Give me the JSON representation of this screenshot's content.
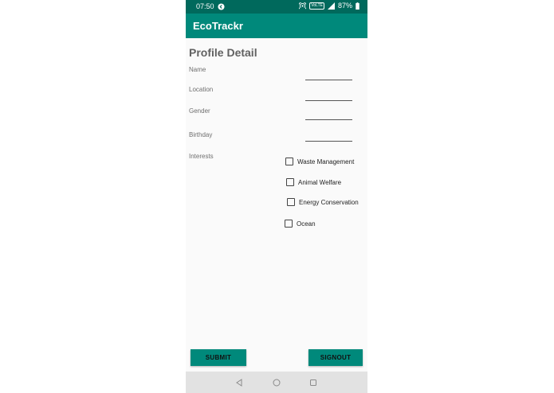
{
  "status_bar": {
    "time": "07:50",
    "volte": "VoLTE",
    "battery": "87%",
    "icons": [
      "notification-icon",
      "hotspot-icon",
      "signal-icon",
      "battery-icon"
    ]
  },
  "app_bar": {
    "title": "EcoTrackr"
  },
  "page": {
    "title": "Profile Detail",
    "fields": [
      {
        "label": "Name",
        "value": ""
      },
      {
        "label": "Location",
        "value": ""
      },
      {
        "label": "Gender",
        "value": ""
      },
      {
        "label": "Birthday",
        "value": ""
      }
    ],
    "interests_label": "Interests",
    "interests": [
      {
        "label": "Waste Management",
        "checked": false
      },
      {
        "label": "Animal Welfare",
        "checked": false
      },
      {
        "label": "Energy Conservation",
        "checked": false
      },
      {
        "label": "Ocean",
        "checked": false
      }
    ]
  },
  "buttons": {
    "submit": "SUBMIT",
    "signout": "SIGNOUT"
  },
  "nav": {
    "items": [
      "back-icon",
      "home-icon",
      "recents-icon"
    ]
  },
  "colors": {
    "status_bar": "#00695c",
    "app_bar": "#00897b",
    "button": "#00897b",
    "background": "#fafafa"
  }
}
